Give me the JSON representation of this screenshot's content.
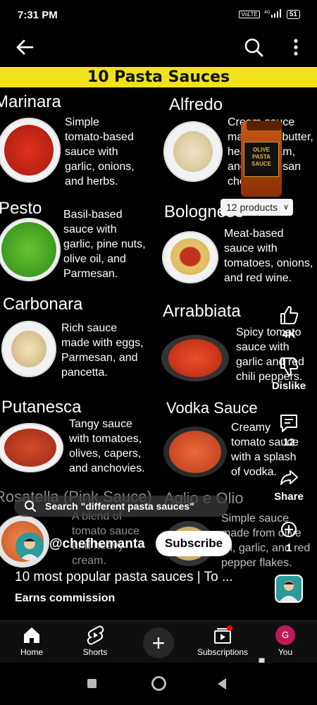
{
  "status": {
    "time": "7:31 PM",
    "volte": "VoLTE",
    "signal": "4G",
    "battery": "51"
  },
  "banner": {
    "title": "10 Pasta Sauces"
  },
  "sauces": [
    {
      "name": "Marinara",
      "desc": [
        "Simple",
        "tomato-based",
        "sauce with",
        "garlic, onions,",
        "and herbs."
      ]
    },
    {
      "name": "Alfredo",
      "desc": [
        "Cream sauce",
        "made with butter,",
        "heavy cream,",
        "and Parmesan",
        "cheese."
      ]
    },
    {
      "name": "Pesto",
      "desc": [
        "Basil-based",
        "sauce with",
        "garlic, pine nuts,",
        "olive oil, and",
        "Parmesan."
      ]
    },
    {
      "name": "Bolognese",
      "desc": [
        "Meat-based",
        "sauce with",
        "tomatoes, onions,",
        "and red wine."
      ]
    },
    {
      "name": "Carbonara",
      "desc": [
        "Rich sauce",
        "made with eggs,",
        "Parmesan, and",
        "pancetta."
      ]
    },
    {
      "name": "Arrabbiata",
      "desc": [
        "Spicy tomato",
        "sauce with",
        "garlic and red",
        "chili peppers."
      ]
    },
    {
      "name": "Putanesca",
      "desc": [
        "Tangy sauce",
        "with tomatoes,",
        "olives, capers,",
        "and anchovies."
      ]
    },
    {
      "name": "Vodka Sauce",
      "desc": [
        "Creamy",
        "tomato sauce",
        "with a splash",
        "of vodka."
      ]
    },
    {
      "name": "Rosatella (Pink Sauce)",
      "desc": [
        "A blend of",
        "tomato sauce",
        "and heavy",
        "cream."
      ]
    },
    {
      "name": "Aglio e Olio",
      "desc": [
        "Simple sauce",
        "made from olive",
        "oil, garlic, and red",
        "pepper flakes."
      ]
    }
  ],
  "product": {
    "jar_brand": "OLIVE",
    "jar_text": "PASTA SAUCE",
    "chip_label": "12 products"
  },
  "actions": {
    "like_count": "4K",
    "dislike_label": "Dislike",
    "comment_count": "12",
    "share_label": "Share",
    "remix_count": "1"
  },
  "search_suggestion": "Search \"different pasta sauces\"",
  "channel": {
    "handle": "@chefhemanta",
    "subscribe_label": "Subscribe"
  },
  "video": {
    "title": "10 most popular  pasta sauces | To ...",
    "earns": "Earns commission"
  },
  "bottom_nav": {
    "home": "Home",
    "shorts": "Shorts",
    "subscriptions": "Subscriptions",
    "you": "You",
    "you_initial": "G"
  },
  "watermark": "olx",
  "colors": {
    "banner": "#f3e21b",
    "notification": "#ff0000",
    "you_avatar": "#c2185b"
  }
}
